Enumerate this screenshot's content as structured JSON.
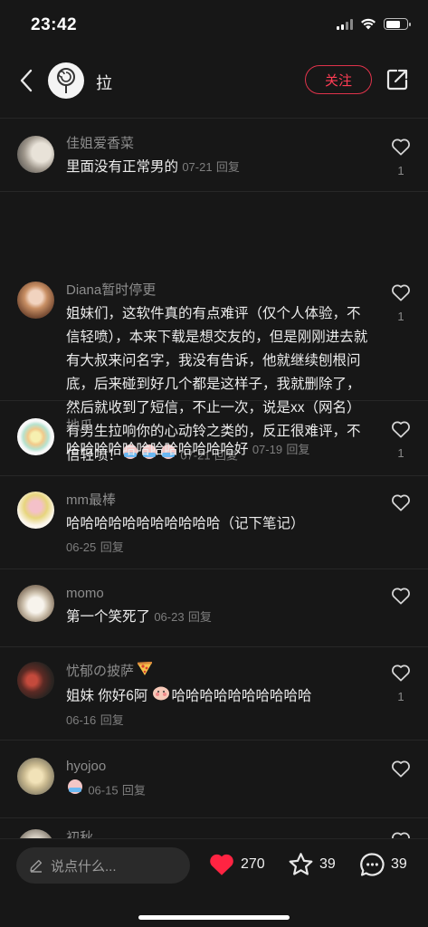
{
  "status_bar": {
    "time": "23:42"
  },
  "header": {
    "name": "拉",
    "follow_label": "关注"
  },
  "comments": [
    {
      "user": "佳姐爱香菜",
      "text": "里面没有正常男的",
      "date": "07-21",
      "reply": "回复",
      "likes": "1"
    },
    {
      "user": "Diana暂时停更",
      "text": "姐妹们，这软件真的有点难评（仅个人体验，不信轻喷），本来下载是想交友的，但是刚刚进去就有大叔来问名字，我没有告诉，他就继续刨根问底，后来碰到好几个都是这样子，我就删除了，然后就收到了短信，不止一次，说是xx（网名）有男生拉响你的心动铃之类的，反正很难评，不信轻喷！",
      "date": "07-21",
      "reply": "回复",
      "likes": "1"
    },
    {
      "user": "地瓜",
      "text": "哈哈哈哈哈哈哈哈哈哈哈哈好",
      "date": "07-19",
      "reply": "回复",
      "likes": "1"
    },
    {
      "user": "mm最棒",
      "text": "哈哈哈哈哈哈哈哈哈哈哈（记下笔记）",
      "date": "06-25",
      "reply": "回复",
      "likes": ""
    },
    {
      "user": "momo",
      "text": "第一个笑死了",
      "date": "06-23",
      "reply": "回复",
      "likes": ""
    },
    {
      "user": "忧郁の披萨",
      "text_a": "姐妹 你好6阿",
      "text_b": "哈哈哈哈哈哈哈哈哈哈",
      "date": "06-16",
      "reply": "回复",
      "likes": "1"
    },
    {
      "user": "hyojoo",
      "text": "",
      "date": "06-15",
      "reply": "回复",
      "likes": ""
    },
    {
      "user": "初秋",
      "text": "",
      "date": "",
      "reply": "",
      "likes": ""
    }
  ],
  "bottom_bar": {
    "placeholder": "说点什么...",
    "likes": "270",
    "favorites": "39",
    "comments": "39"
  },
  "colors": {
    "accent": "#ff3d55",
    "heart": "#ff2442",
    "background": "#171717"
  }
}
